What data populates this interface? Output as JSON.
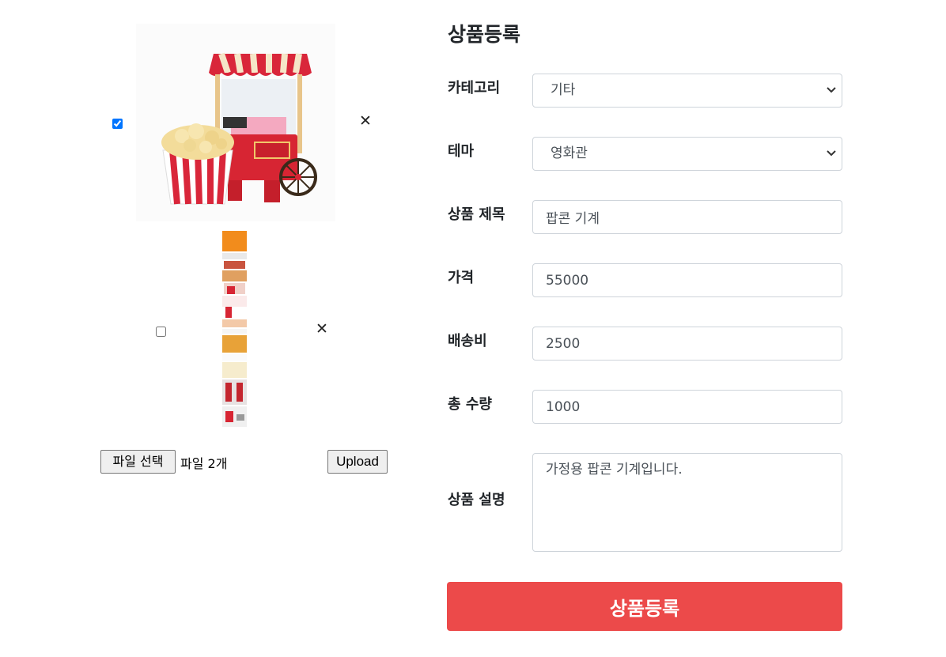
{
  "images": {
    "items": [
      {
        "checked": true,
        "remove_icon": "close-icon",
        "alt": "popcorn machine"
      },
      {
        "checked": false,
        "remove_icon": "close-icon",
        "alt": "detail page strip"
      }
    ],
    "file_button_label": "파일 선택",
    "file_status": "파일 2개",
    "upload_label": "Upload"
  },
  "form": {
    "title": "상품등록",
    "category": {
      "label": "카테고리",
      "value": "기타",
      "icon": "chevron-down-icon"
    },
    "theme": {
      "label": "테마",
      "value": "영화관",
      "icon": "chevron-down-icon"
    },
    "product_title": {
      "label": "상품 제목",
      "value": "팝콘 기계"
    },
    "price": {
      "label": "가격",
      "value": "55000"
    },
    "shipping": {
      "label": "배송비",
      "value": "2500"
    },
    "quantity": {
      "label": "총 수량",
      "value": "1000"
    },
    "description": {
      "label": "상품 설명",
      "value": "가정용 팝콘 기계입니다."
    },
    "submit_label": "상품등록"
  },
  "colors": {
    "accent": "#ec4a4a",
    "checkbox": "#0075ff"
  }
}
